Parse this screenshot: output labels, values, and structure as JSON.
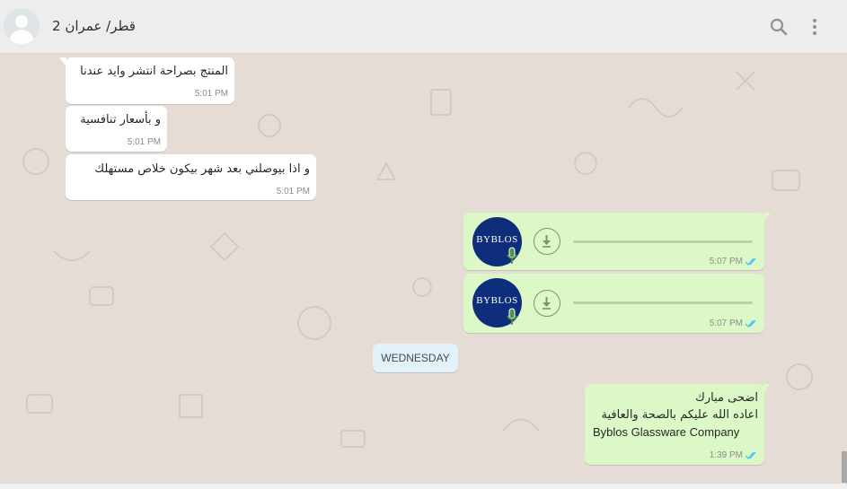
{
  "header": {
    "contact_name": "قطر/ عمران 2"
  },
  "messages": [
    {
      "direction": "in",
      "text": "المنتج بصراحة انتشر وايد عندنا",
      "time": "5:01 PM"
    },
    {
      "direction": "in",
      "text": "و بأسعار تنافسية",
      "time": "5:01 PM"
    },
    {
      "direction": "in",
      "text": "و اذا بيوصلني بعد شهر بيكون خلاص مستهلك",
      "time": "5:01 PM"
    },
    {
      "direction": "out",
      "type": "voice",
      "sender_logo": "BYBLOS",
      "time": "5:07 PM",
      "status": "read"
    },
    {
      "direction": "out",
      "type": "voice",
      "sender_logo": "BYBLOS",
      "time": "5:07 PM",
      "status": "read"
    },
    {
      "direction": "out",
      "lines": [
        "اضحى مبارك",
        "اعاده الله عليكم بالصحة والعافية",
        "Byblos Glassware Company"
      ],
      "time": "1:39 PM",
      "status": "read"
    }
  ],
  "day_divider": "WEDNESDAY",
  "colors": {
    "chat_bg": "#e5ddd5",
    "incoming_bubble": "#ffffff",
    "outgoing_bubble": "#dcf8c6",
    "read_ticks": "#4fc3f7",
    "logo_bg": "#0e2e7c"
  },
  "icons": [
    "default-avatar-icon",
    "search-icon",
    "menu-icon",
    "download-icon",
    "mic-icon",
    "double-check-icon"
  ]
}
